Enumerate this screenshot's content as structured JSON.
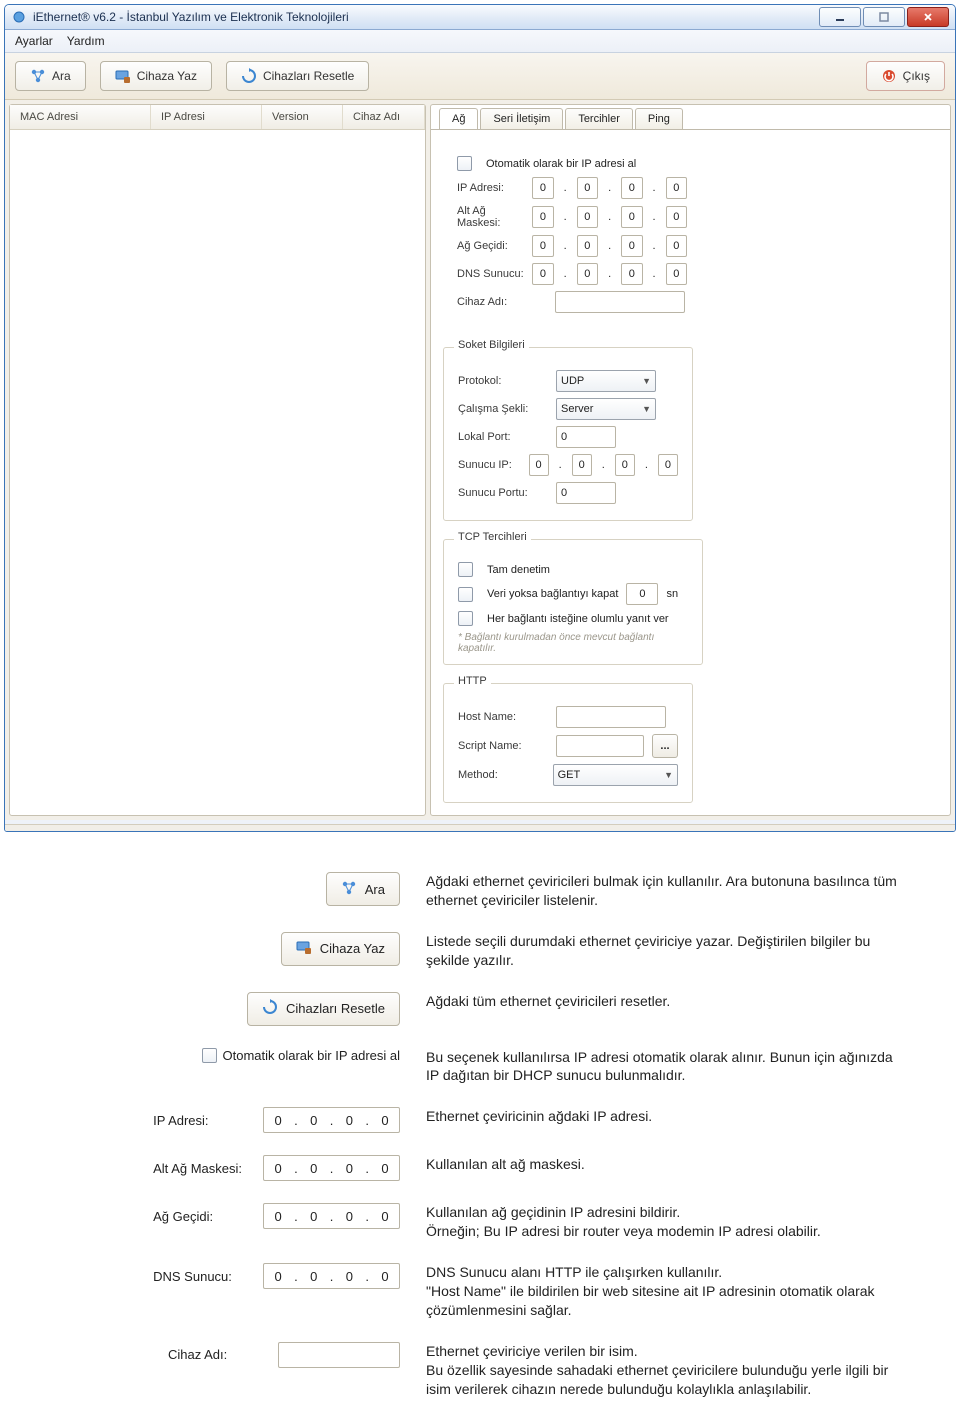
{
  "window": {
    "title": "iEthernet® v6.2 - İstanbul Yazılım ve Elektronik Teknolojileri"
  },
  "menu": {
    "settings": "Ayarlar",
    "help": "Yardım"
  },
  "toolbar": {
    "search": "Ara",
    "write": "Cihaza Yaz",
    "reset": "Cihazları Resetle",
    "exit": "Çıkış"
  },
  "list": {
    "mac": "MAC Adresi",
    "ip": "IP Adresi",
    "ver": "Version",
    "name": "Cihaz Adı"
  },
  "tabs": {
    "net": "Ağ",
    "serial": "Seri İletişim",
    "prefs": "Tercihler",
    "ping": "Ping"
  },
  "net": {
    "autoip_label": "Otomatik olarak bir IP adresi al",
    "ip_label": "IP Adresi:",
    "mask_label": "Alt Ağ Maskesi:",
    "gw_label": "Ağ Geçidi:",
    "dns_label": "DNS Sunucu:",
    "devname_label": "Cihaz Adı:",
    "octet": "0",
    "devname_value": ""
  },
  "socket": {
    "title": "Soket Bilgileri",
    "proto_label": "Protokol:",
    "proto_value": "UDP",
    "mode_label": "Çalışma Şekli:",
    "mode_value": "Server",
    "lport_label": "Lokal Port:",
    "lport_value": "0",
    "sip_label": "Sunucu IP:",
    "sport_label": "Sunucu Portu:",
    "sport_value": "0"
  },
  "tcp": {
    "title": "TCP Tercihleri",
    "full_label": "Tam denetim",
    "idle_label": "Veri yoksa bağlantıyı kapat",
    "idle_value": "0",
    "idle_unit": "sn",
    "accept_label": "Her bağlantı isteğine olumlu yanıt ver",
    "hint": "* Bağlantı kurulmadan önce mevcut bağlantı kapatılır."
  },
  "http": {
    "title": "HTTP",
    "host_label": "Host Name:",
    "script_label": "Script Name:",
    "method_label": "Method:",
    "method_value": "GET",
    "ellipsis": "..."
  },
  "docs": {
    "ara": "Ağdaki ethernet çeviricileri bulmak için kullanılır. Ara butonuna basılınca tüm ethernet çeviriciler listelenir.",
    "yaz": "Listede seçili durumdaki ethernet çeviriciye yazar. Değiştirilen bilgiler bu şekilde yazılır.",
    "reset": "Ağdaki tüm ethernet çeviricileri resetler.",
    "autoip": "Bu seçenek kullanılırsa IP adresi otomatik olarak alınır. Bunun için ağınızda IP dağıtan bir DHCP sunucu bulunmalıdır.",
    "ip": "Ethernet çeviricinin ağdaki IP adresi.",
    "mask": "Kullanılan alt ağ maskesi.",
    "gw1": "Kullanılan ağ geçidinin IP adresini bildirir.",
    "gw2": "Örneğin; Bu IP adresi bir router veya modemin IP adresi olabilir.",
    "dns1": "DNS Sunucu alanı HTTP ile çalışırken kullanılır.",
    "dns2": "\"Host Name\" ile bildirilen bir web sitesine ait IP adresinin otomatik olarak çözümlenmesini sağlar.",
    "name1": "Ethernet çeviriciye verilen bir isim.",
    "name2": "Bu özellik sayesinde sahadaki ethernet çeviricilere bulunduğu yerle ilgili bir isim verilerek cihazın nerede bulunduğu kolaylıkla anlaşılabilir."
  }
}
